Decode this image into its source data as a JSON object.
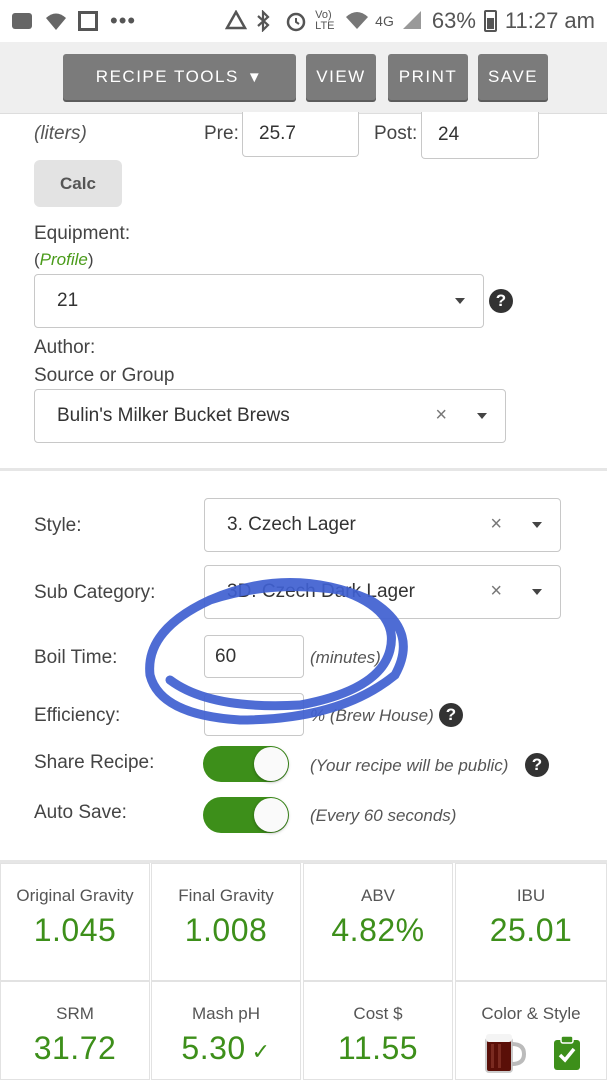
{
  "status_bar": {
    "battery": "63%",
    "time": "11:27 am",
    "network": "4G",
    "volte": "Vo) LTE",
    "menu_dots": "•••"
  },
  "toolbar": {
    "recipe_tools": "RECIPE TOOLS",
    "caret": "▼",
    "view": "VIEW",
    "print": "PRINT",
    "save": "SAVE"
  },
  "volume": {
    "unit": "(liters)",
    "pre_label": "Pre:",
    "pre_value": "25.7",
    "post_label": "Post:",
    "post_value": "24",
    "calc": "Calc"
  },
  "equipment": {
    "label": "Equipment:",
    "profile_open": "(",
    "profile_link": "Profile",
    "profile_close": ")",
    "value": "21"
  },
  "author": {
    "label": "Author:",
    "sub_label": "Source or Group",
    "value": "Bulin's Milker Bucket Brews"
  },
  "style": {
    "label": "Style:",
    "value": "3. Czech Lager"
  },
  "sub_category": {
    "label": "Sub Category:",
    "value": "3D. Czech Dark Lager"
  },
  "boil": {
    "label": "Boil Time:",
    "value": "60",
    "unit": "(minutes)"
  },
  "efficiency": {
    "label": "Efficiency:",
    "value": "",
    "unit": "% (Brew House)"
  },
  "share": {
    "label": "Share Recipe:",
    "note": "(Your recipe will be public)",
    "on": true
  },
  "autosave": {
    "label": "Auto Save:",
    "note": "(Every 60 seconds)",
    "on": true
  },
  "stats": {
    "og": {
      "label": "Original Gravity",
      "value": "1.045"
    },
    "fg": {
      "label": "Final Gravity",
      "value": "1.008"
    },
    "abv": {
      "label": "ABV",
      "value": "4.82%"
    },
    "ibu": {
      "label": "IBU",
      "value": "25.01"
    },
    "srm": {
      "label": "SRM",
      "value": "31.72"
    },
    "ph": {
      "label": "Mash pH",
      "value": "5.30",
      "check": "✓"
    },
    "cost": {
      "label": "Cost $",
      "value": "11.55"
    },
    "color": {
      "label": "Color & Style"
    }
  },
  "colors": {
    "accent_green": "#3d8f1a",
    "button_gray": "#7b7b7b",
    "annotation_blue": "#3f5fd0",
    "beer_color": "#5a0f08"
  },
  "help_glyph": "?",
  "clear_glyph": "×"
}
